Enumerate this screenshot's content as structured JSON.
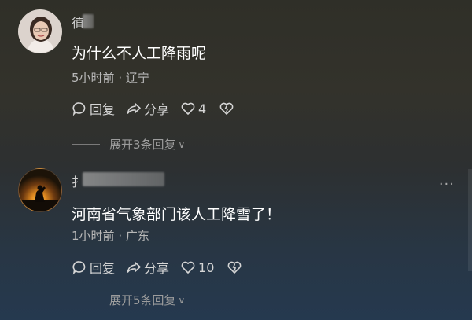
{
  "comments": [
    {
      "username": "徝",
      "text": "为什么不人工降雨呢",
      "time": "5小时前",
      "separator": "·",
      "location": "辽宁",
      "reply_label": "回复",
      "share_label": "分享",
      "like_count": "4",
      "expand_label": "展开3条回复"
    },
    {
      "username": "扌",
      "text": "河南省气象部门该人工降雪了！",
      "time": "1小时前",
      "separator": "·",
      "location": "广东",
      "reply_label": "回复",
      "share_label": "分享",
      "like_count": "10",
      "expand_label": "展开5条回复"
    }
  ],
  "more_menu": "···",
  "icons": [
    "comment-bubble-icon",
    "share-arrow-icon",
    "heart-icon",
    "dislike-heart-icon",
    "chevron-down-icon",
    "more-dots-icon"
  ],
  "colors": {
    "text_primary": "#ffffff",
    "text_secondary": "#b8b8b8",
    "text_muted": "#9c9c9c"
  }
}
